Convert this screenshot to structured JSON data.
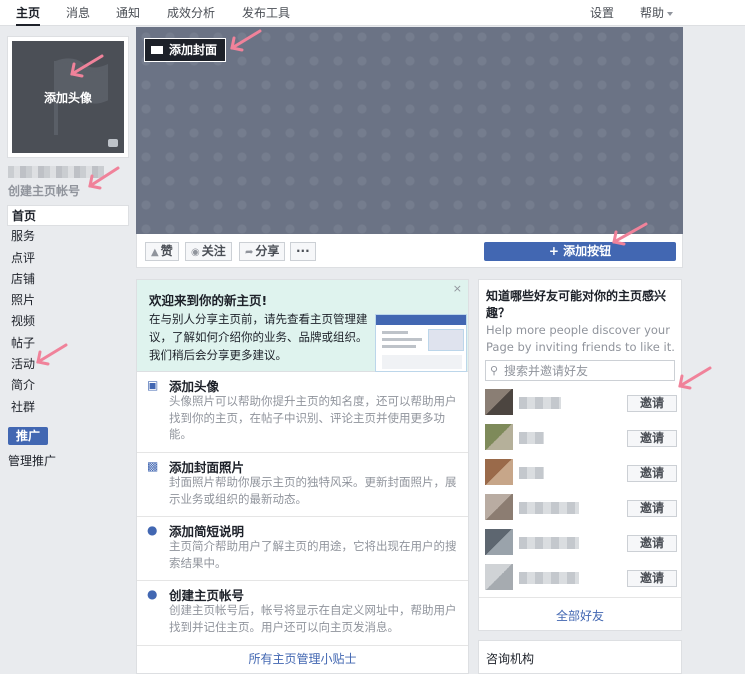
{
  "topnav": {
    "tabs": [
      {
        "label": "主页"
      },
      {
        "label": "消息"
      },
      {
        "label": "通知"
      },
      {
        "label": "成效分析"
      },
      {
        "label": "发布工具"
      }
    ],
    "settings": "设置",
    "help": "帮助"
  },
  "profile": {
    "add_avatar": "添加头像",
    "create_account": "创建主页帐号"
  },
  "leftnav": {
    "items": [
      {
        "label": "首页"
      },
      {
        "label": "服务"
      },
      {
        "label": "点评"
      },
      {
        "label": "店铺"
      },
      {
        "label": "照片"
      },
      {
        "label": "视频"
      },
      {
        "label": "帖子"
      },
      {
        "label": "活动"
      },
      {
        "label": "简介"
      },
      {
        "label": "社群"
      }
    ],
    "promote": "推广",
    "manage_promotions": "管理推广"
  },
  "cover": {
    "add_cover": "添加封面"
  },
  "actions": {
    "like": "赞",
    "follow": "关注",
    "share": "分享",
    "more": "···",
    "add_button": "+ 添加按钮"
  },
  "welcome": {
    "title": "欢迎来到你的新主页!",
    "body": "在与别人分享主页前，请先查看主页管理建议，了解如何介绍你的业务、品牌或组织。我们稍后会分享更多建议。",
    "close": "×",
    "tips": [
      {
        "icon": "avatar-icon",
        "title": "添加头像",
        "desc": "头像照片可以帮助你提升主页的知名度，还可以帮助用户找到你的主页，在帖子中识别、评论主页并使用更多功能。"
      },
      {
        "icon": "photo-icon",
        "title": "添加封面照片",
        "desc": "封面照片帮助你展示主页的独特风采。更新封面照片，展示业务或组织的最新动态。"
      },
      {
        "icon": "bulb-icon",
        "title": "添加简短说明",
        "desc": "主页简介帮助用户了解主页的用途，它将出现在用户的搜索结果中。"
      },
      {
        "icon": "bulb-icon",
        "title": "创建主页帐号",
        "desc": "创建主页帐号后，帐号将显示在自定义网址中，帮助用户找到并记住主页。用户还可以向主页发消息。"
      }
    ],
    "all_tips": "所有主页管理小贴士"
  },
  "friends": {
    "title": "知道哪些好友可能对你的主页感兴趣？",
    "subtitle": "Help more people discover your Page by inviting friends to like it.",
    "search_placeholder": "搜索并邀请好友",
    "invite_label": "邀请",
    "rows": [
      {
        "avatar_colors": [
          "#8a7e74",
          "#4c4540"
        ],
        "name_blur": 0.42
      },
      {
        "avatar_colors": [
          "#7e8a5a",
          "#b5b09a"
        ],
        "name_blur": 0.25
      },
      {
        "avatar_colors": [
          "#9a6a4a",
          "#c7a689"
        ],
        "name_blur": 0.25
      },
      {
        "avatar_colors": [
          "#b9aca2",
          "#8c7d72"
        ],
        "name_blur": 0.6
      },
      {
        "avatar_colors": [
          "#5d6670",
          "#9aa3ab"
        ],
        "name_blur": 0.6
      },
      {
        "avatar_colors": [
          "#d0d3d6",
          "#a6abb0"
        ],
        "name_blur": 0.6
      }
    ],
    "all_friends": "全部好友"
  },
  "category": {
    "label": "咨询机构"
  }
}
